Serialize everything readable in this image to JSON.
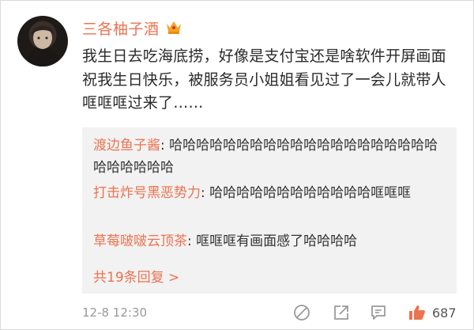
{
  "user": {
    "name": "三各柚子酒",
    "badge_icon": "crown-icon"
  },
  "post": {
    "text": "我生日去吃海底捞，好像是支付宝还是啥软件开屏画面祝我生日快乐，被服务员小姐姐看见过了一会儿就带人哐哐哐过来了……"
  },
  "comments": [
    {
      "author": "渡边鱼子酱",
      "text": "哈哈哈哈哈哈哈哈哈哈哈哈哈哈哈哈哈哈哈哈哈哈哈哈哈哈"
    },
    {
      "author": "打击炸号黑恶势力",
      "text": "哈哈哈哈哈哈哈哈哈哈哈哈哐哐哐"
    },
    {
      "author": "草莓啵啵云顶茶",
      "text": "哐哐哐有画面感了哈哈哈哈"
    }
  ],
  "comments_more": "共19条回复 >",
  "footer": {
    "timestamp": "12-8 12:30",
    "like_count": "687",
    "icons": [
      "hide-icon",
      "comment-icon",
      "share-icon",
      "like-icon"
    ]
  },
  "colors": {
    "accent": "#eb7350",
    "comment_bg": "#f2f2f2",
    "meta": "#9a9a9a"
  }
}
